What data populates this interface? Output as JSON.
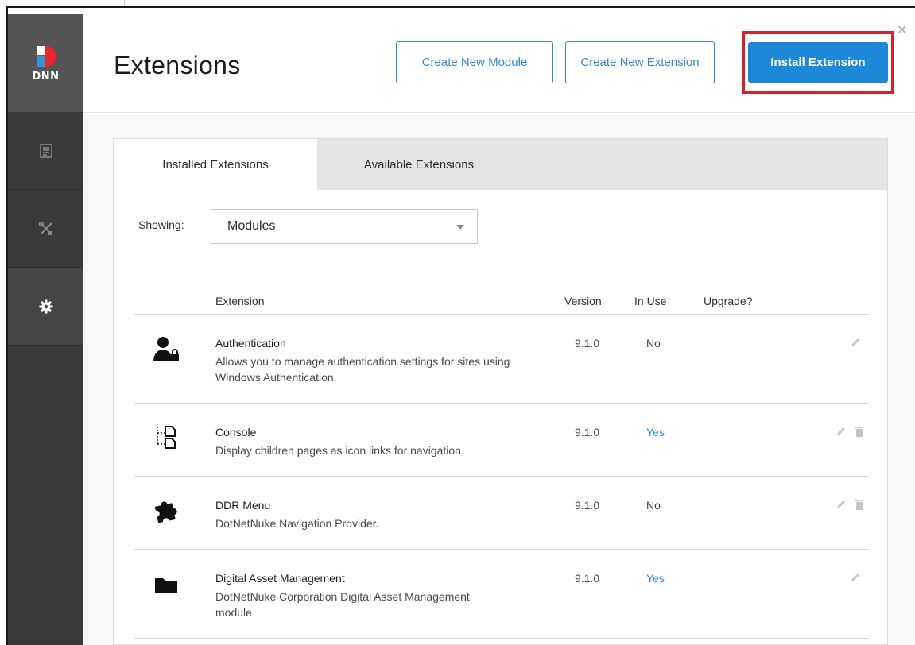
{
  "header": {
    "title": "Extensions",
    "buttons": {
      "create_module": "Create New Module",
      "create_extension": "Create New Extension",
      "install_extension": "Install Extension"
    }
  },
  "sidebar": {
    "logo_text": "DNN",
    "items": [
      {
        "icon": "content-icon"
      },
      {
        "icon": "tools-icon"
      },
      {
        "icon": "settings-gear-icon",
        "active": true
      }
    ]
  },
  "tabs": [
    {
      "label": "Installed Extensions",
      "active": true
    },
    {
      "label": "Available Extensions",
      "active": false
    }
  ],
  "filter": {
    "label": "Showing:",
    "selected": "Modules"
  },
  "table": {
    "columns": {
      "extension": "Extension",
      "version": "Version",
      "in_use": "In Use",
      "upgrade": "Upgrade?"
    },
    "rows": [
      {
        "icon": "user-lock-icon",
        "name": "Authentication",
        "description": "Allows you to manage authentication settings for sites using Windows Authentication.",
        "version": "9.1.0",
        "in_use": "No",
        "actions": [
          "edit"
        ]
      },
      {
        "icon": "console-sitemap-icon",
        "name": "Console",
        "description": "Display children pages as icon links for navigation.",
        "version": "9.1.0",
        "in_use": "Yes",
        "actions": [
          "edit",
          "delete"
        ]
      },
      {
        "icon": "puzzle-piece-icon",
        "name": "DDR Menu",
        "description": "DotNetNuke Navigation Provider.",
        "version": "9.1.0",
        "in_use": "No",
        "actions": [
          "edit",
          "delete"
        ]
      },
      {
        "icon": "folder-icon",
        "name": "Digital Asset Management",
        "description": "DotNetNuke Corporation Digital Asset Management module",
        "version": "9.1.0",
        "in_use": "Yes",
        "actions": [
          "edit"
        ]
      }
    ]
  },
  "colors": {
    "accent": "#1e88d8",
    "highlight": "#d6222b",
    "sidebar": "#3a3a3a",
    "logo_red": "#e8272d",
    "logo_blue": "#3496d8"
  }
}
